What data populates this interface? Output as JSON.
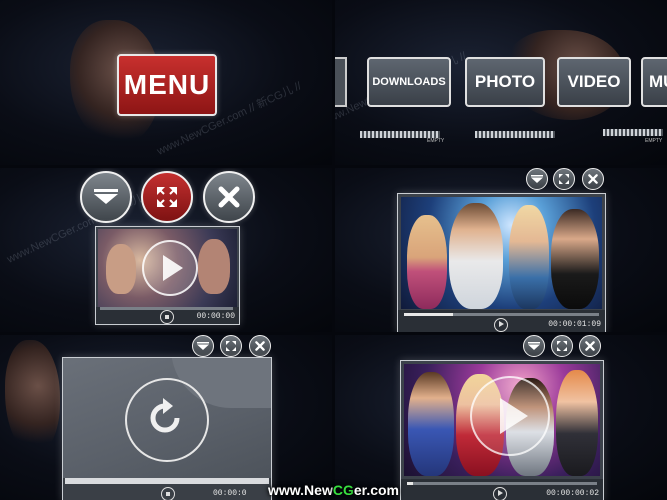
{
  "panel1": {
    "menu_label": "MENU"
  },
  "panel2": {
    "buttons": [
      {
        "label": "DOWNLOADS"
      },
      {
        "label": "PHOTO"
      },
      {
        "label": "VIDEO"
      },
      {
        "label": "MU"
      }
    ],
    "strip_label_1": "EMPTY",
    "strip_label_2": "EMPTY"
  },
  "panel3": {
    "timecode": "00:00:00"
  },
  "panel4": {
    "timecode": "00:00:01:09"
  },
  "panel5": {
    "timecode": "00:00:0"
  },
  "panel6": {
    "timecode": "00:00:00:02"
  },
  "watermarks": [
    "www.NewCGer.com // 新CG儿 //",
    "www.NewCGer.com // 新CG儿 //"
  ],
  "site": {
    "prefix": "www.",
    "brand_a": "New",
    "brand_b": "CG",
    "brand_c": "er",
    "suffix": ".com"
  },
  "colors": {
    "menu_red": "#b32222",
    "panel_bg": "#0a0d16",
    "accent_green": "#38e040"
  },
  "icons": [
    "minimize-icon",
    "fullscreen-icon",
    "close-icon",
    "play-icon",
    "stop-icon",
    "replay-icon"
  ]
}
